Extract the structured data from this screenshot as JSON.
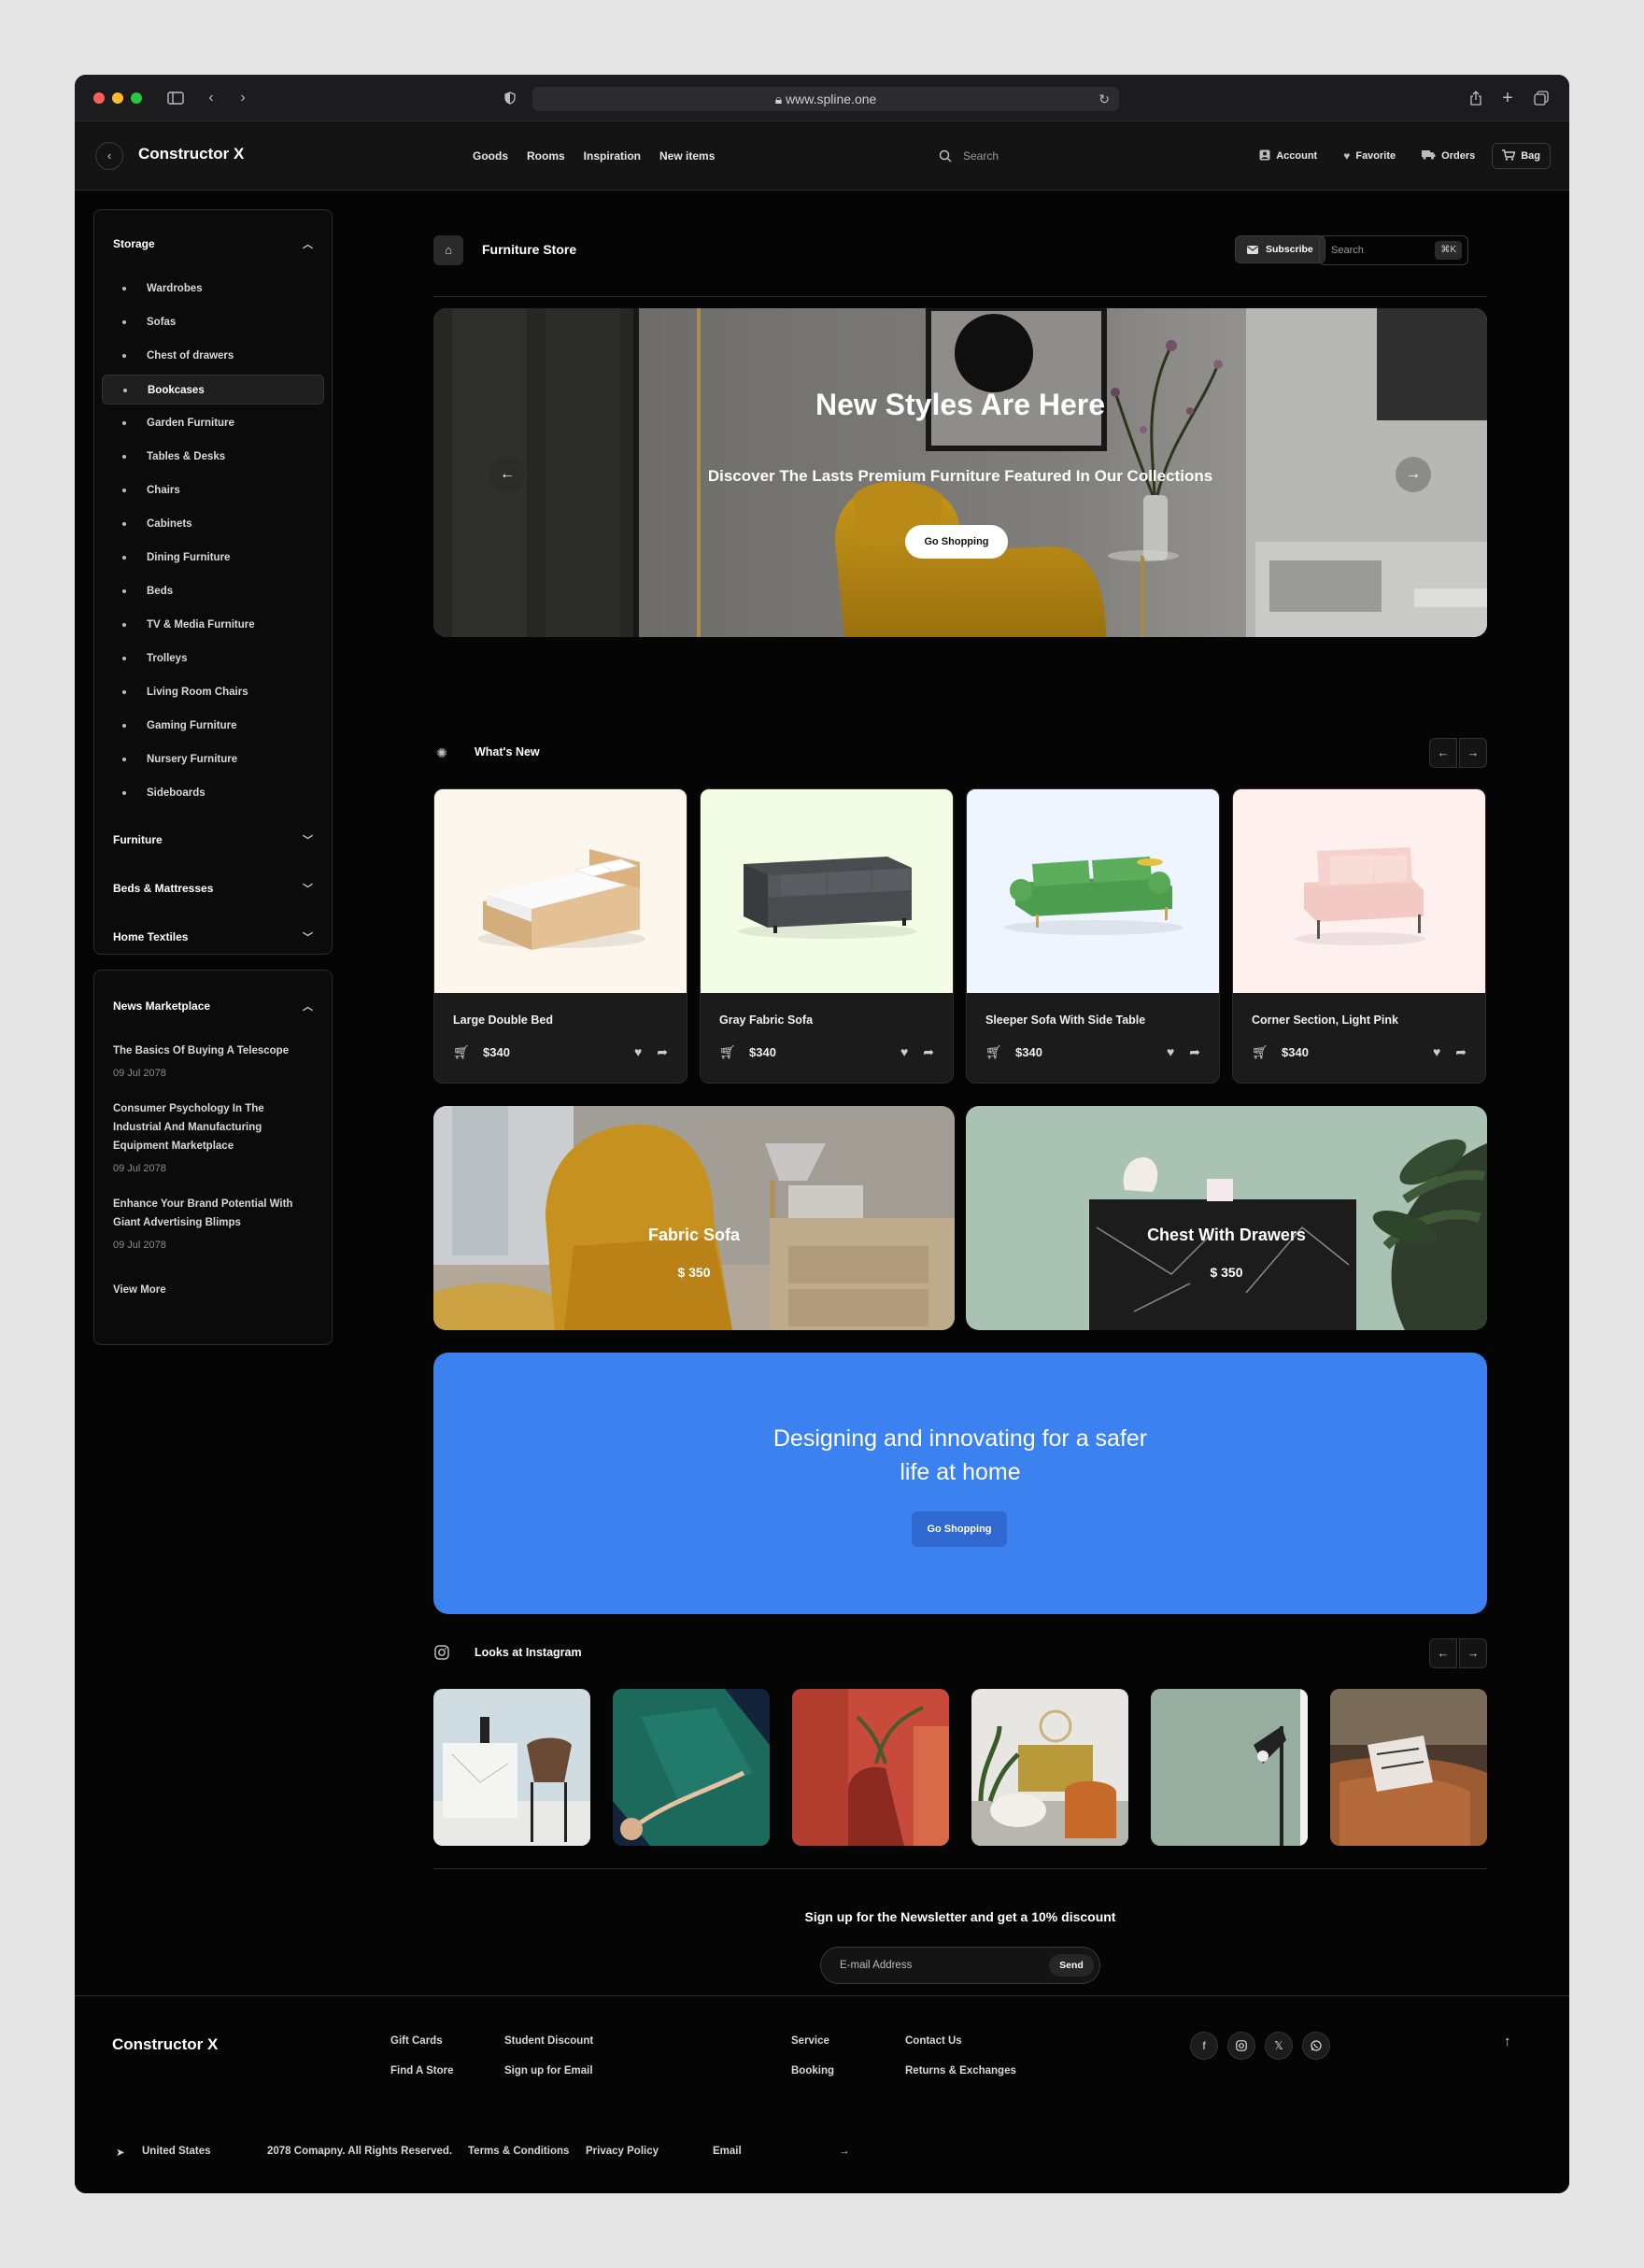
{
  "browser": {
    "url": "www.spline.one"
  },
  "header": {
    "brand": "Constructor X",
    "nav": [
      "Goods",
      "Rooms",
      "Inspiration",
      "New items"
    ],
    "search_placeholder": "Search",
    "actions": [
      {
        "label": "Account",
        "icon": "account-icon"
      },
      {
        "label": "Favorite",
        "icon": "heart-icon"
      },
      {
        "label": "Orders",
        "icon": "truck-icon"
      },
      {
        "label": "Bag",
        "icon": "cart-icon"
      }
    ]
  },
  "sidebar": {
    "storage": {
      "title": "Storage",
      "items": [
        "Wardrobes",
        "Sofas",
        "Chest of drawers",
        "Bookcases",
        "Garden Furniture",
        "Tables & Desks",
        "Chairs",
        "Cabinets",
        "Dining Furniture",
        "Beds",
        "TV & Media Furniture",
        "Trolleys",
        "Living Room Chairs",
        "Gaming Furniture",
        "Nursery Furniture",
        "Sideboards"
      ],
      "active": "Bookcases"
    },
    "categories": [
      "Furniture",
      "Beds & Mattresses",
      "Home Textiles"
    ],
    "news": {
      "title": "News Marketplace",
      "items": [
        {
          "title": "The Basics Of Buying A Telescope",
          "date": "09 Jul 2078"
        },
        {
          "title": "Consumer Psychology In The Industrial And Manufacturing Equipment Marketplace",
          "date": "09 Jul 2078"
        },
        {
          "title": "Enhance Your Brand Potential With Giant Advertising Blimps",
          "date": "09 Jul 2078"
        }
      ],
      "view_more": "View More"
    }
  },
  "main": {
    "breadcrumb": "Furniture Store",
    "subscribe": "Subscribe",
    "search_placeholder": "Search",
    "search_shortcut": "⌘K",
    "hero": {
      "title": "New Styles Are Here",
      "subtitle": "Discover The Lasts Premium Furniture Featured In Our Collections",
      "button": "Go Shopping"
    },
    "whats_new": {
      "title": "What's New",
      "products": [
        {
          "name": "Large Double Bed",
          "price": "$340",
          "bg": "#fdf6ec"
        },
        {
          "name": "Gray Fabric Sofa",
          "price": "$340",
          "bg": "#f3fde6"
        },
        {
          "name": "Sleeper Sofa With Side Table",
          "price": "$340",
          "bg": "#eef5ff"
        },
        {
          "name": "Corner Section, Light Pink",
          "price": "$340",
          "bg": "#fff0f0"
        }
      ]
    },
    "featured": [
      {
        "title": "Fabric Sofa",
        "price": "$ 350"
      },
      {
        "title": "Chest With Drawers",
        "price": "$ 350"
      }
    ],
    "banner": {
      "line1": "Designing and innovating for a safer",
      "line2": "life at home",
      "button": "Go Shopping",
      "color": "#3b82f0"
    },
    "instagram": {
      "title": "Looks at Instagram"
    },
    "newsletter": {
      "cta": "Sign up for the Newsletter and get a 10% discount",
      "placeholder": "E-mail Address",
      "button": "Send"
    }
  },
  "footer": {
    "brand": "Constructor X",
    "links_a": [
      "Gift Cards",
      "Find A Store"
    ],
    "links_b": [
      "Student Discount",
      "Sign up for Email"
    ],
    "links_c": [
      "Service",
      "Booking"
    ],
    "links_d": [
      "Contact Us",
      "Returns & Exchanges"
    ],
    "social": [
      "facebook-icon",
      "instagram-icon",
      "x-icon",
      "whatsapp-icon"
    ],
    "country": "United States",
    "copyright": "2078 Comapny. All Rights Reserved.",
    "terms": "Terms & Conditions",
    "privacy": "Privacy Policy",
    "email": "Email"
  }
}
